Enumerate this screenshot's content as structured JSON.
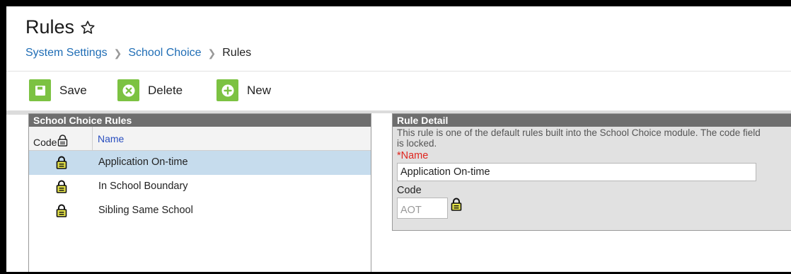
{
  "header": {
    "title": "Rules",
    "breadcrumb": [
      {
        "label": "System Settings"
      },
      {
        "label": "School Choice"
      },
      {
        "label": "Rules"
      }
    ]
  },
  "toolbar": {
    "save_label": "Save",
    "delete_label": "Delete",
    "new_label": "New",
    "accent_color": "#7cc242"
  },
  "rules_panel": {
    "title": "School Choice Rules",
    "col_code": "Code",
    "col_name": "Name",
    "rows": [
      {
        "name": "Application On-time",
        "selected": true,
        "icon": "lock-icon"
      },
      {
        "name": "In School Boundary",
        "selected": false,
        "icon": "lock-icon"
      },
      {
        "name": "Sibling Same School",
        "selected": false,
        "icon": "lock-icon"
      }
    ]
  },
  "detail": {
    "title": "Rule Detail",
    "note": "This rule is one of the default rules built into the School Choice module. The code field is locked.",
    "name_label": "*Name",
    "name_value": "Application On-time",
    "code_label": "Code",
    "code_value": "AOT"
  },
  "colors": {
    "selected_row": "#c6dced",
    "panel_header": "#6e6e6e",
    "required_label": "#e0261f",
    "link": "#1f6db5",
    "lock": "#e8e64a"
  }
}
